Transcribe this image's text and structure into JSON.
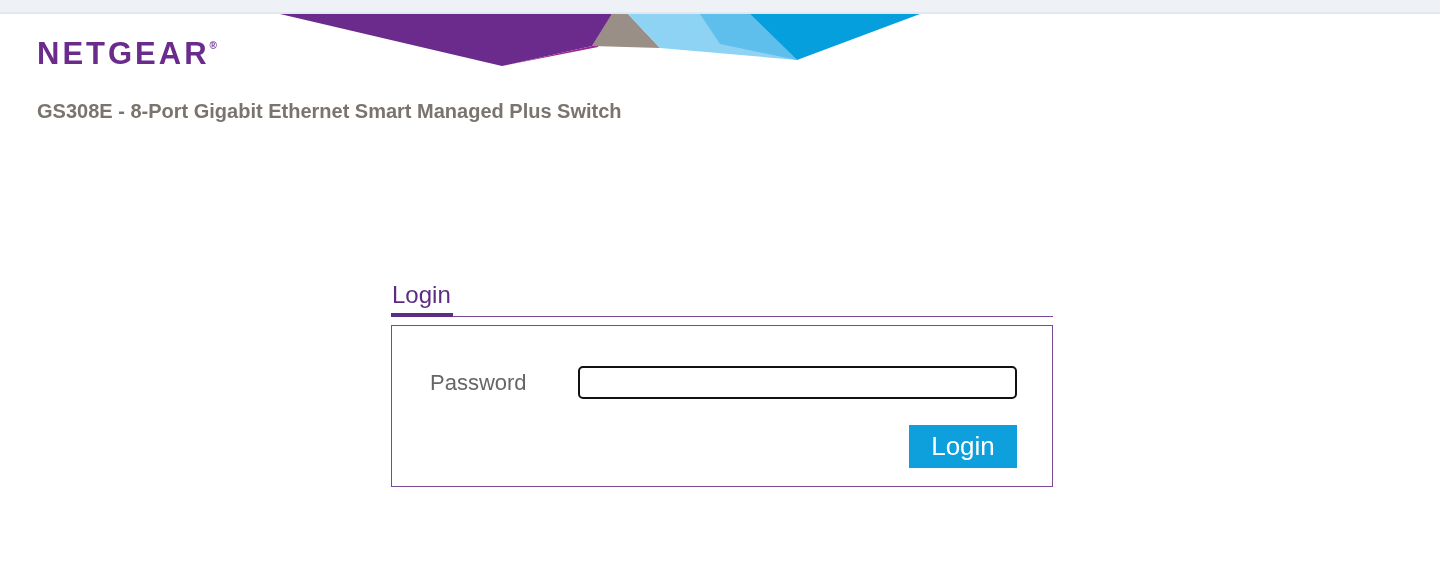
{
  "logo": {
    "text": "NETGEAR",
    "mark": "®"
  },
  "product_title": "GS308E - 8-Port Gigabit Ethernet Smart Managed Plus Switch",
  "tabs": [
    {
      "label": "Login",
      "selected": true
    }
  ],
  "form": {
    "password_label": "Password",
    "password_focused": true,
    "submit": "Login"
  }
}
